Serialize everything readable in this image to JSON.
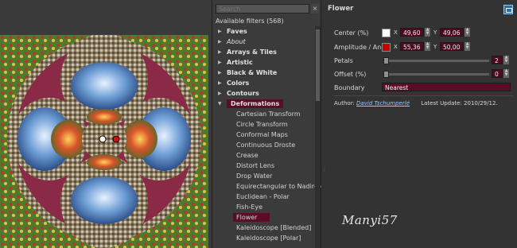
{
  "search": {
    "placeholder": "Search",
    "clear": "×"
  },
  "filters_header": "Available filters (568)",
  "categories_top": [
    {
      "label": "Faves",
      "style": "bold"
    },
    {
      "label": "About",
      "style": "italic"
    },
    {
      "label": "Arrays & Tiles",
      "style": "bold"
    },
    {
      "label": "Artistic",
      "style": "bold"
    },
    {
      "label": "Black & White",
      "style": "bold"
    },
    {
      "label": "Colors",
      "style": "bold"
    },
    {
      "label": "Contours",
      "style": "bold"
    }
  ],
  "open_category": "Deformations",
  "deformation_items": [
    "Cartesian Transform",
    "Circle Transform",
    "Conformal Maps",
    "Continuous Droste",
    "Crease",
    "Distort Lens",
    "Drop Water",
    "Equirectangular to Nadir-Zenith",
    "Euclidean - Polar",
    "Fish-Eye",
    "Flower",
    "Kaleidoscope [Blended]",
    "Kaleidoscope [Polar]"
  ],
  "selected_filter_index": 10,
  "settings": {
    "title": "Flower",
    "center": {
      "label": "Center (%)",
      "color": "#ffffff",
      "x_label": "X",
      "x": "49,60",
      "y_label": "Y",
      "y": "49,06"
    },
    "amplitude": {
      "label": "Amplitude / Angle",
      "color": "#cc0000",
      "x_label": "X",
      "x": "55,36",
      "y_label": "Y",
      "y": "50,00"
    },
    "petals": {
      "label": "Petals",
      "value": "2",
      "fraction": 0.0
    },
    "offset": {
      "label": "Offset (%)",
      "value": "0",
      "fraction": 0.0
    },
    "boundary": {
      "label": "Boundary",
      "value": "Nearest"
    },
    "author_label": "Author:",
    "author_name": "David Tschumperlé",
    "update_label": "Latest Update:",
    "update_date": "2010/29/12."
  },
  "signature": "Manyi57",
  "colors": {
    "accent": "#5a0e26",
    "field_bg": "#4c0a1e",
    "background": "#8a2a47"
  }
}
